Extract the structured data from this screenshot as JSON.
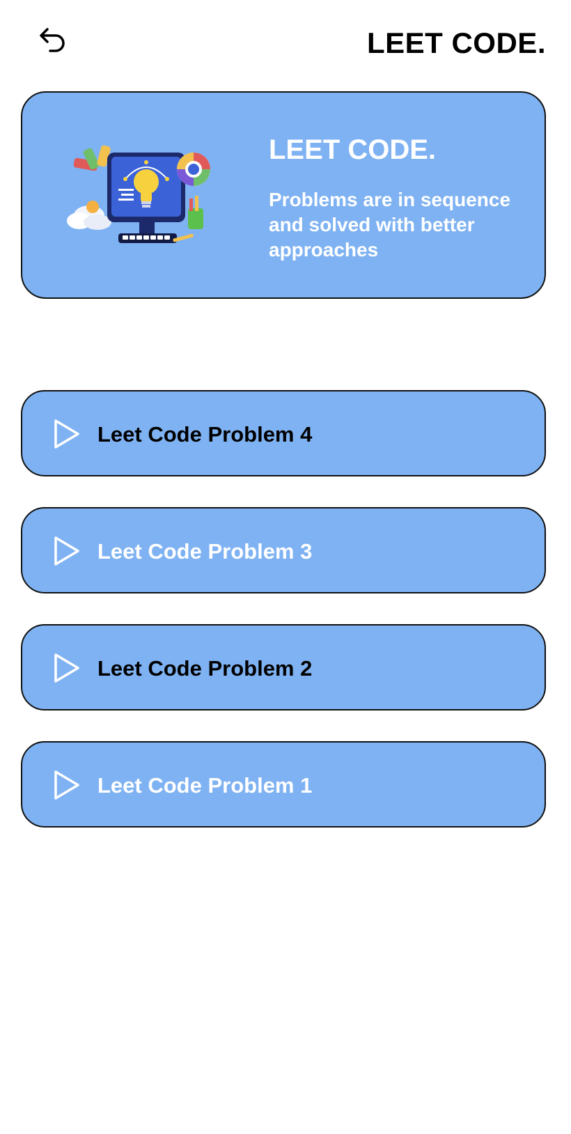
{
  "header": {
    "back_icon": "undo-arrow-icon",
    "title": "LEET CODE."
  },
  "hero": {
    "illustration": "computer-design-illustration",
    "title": "LEET CODE.",
    "subtitle": "Problems are in sequence and solved with better approaches",
    "background": "#7fb2f2"
  },
  "problems": [
    {
      "label": "Leet Code Problem 4",
      "icon": "play-icon",
      "text_color": "#000000"
    },
    {
      "label": "Leet Code Problem 3",
      "icon": "play-icon",
      "text_color": "#ffffff"
    },
    {
      "label": "Leet Code Problem 2",
      "icon": "play-icon",
      "text_color": "#000000"
    },
    {
      "label": "Leet Code Problem 1",
      "icon": "play-icon",
      "text_color": "#ffffff"
    }
  ],
  "colors": {
    "card": "#7fb2f2",
    "border": "#111111",
    "background": "#ffffff"
  }
}
